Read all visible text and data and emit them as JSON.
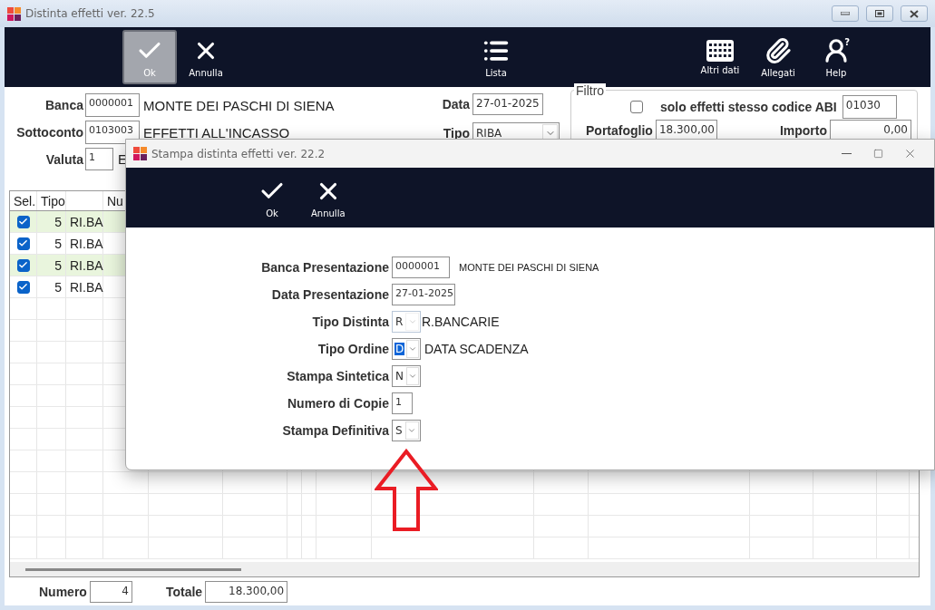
{
  "main_window": {
    "title": "Distinta effetti  ver. 22.5"
  },
  "toolbar": {
    "left": [
      {
        "label": "Ok",
        "active": true
      },
      {
        "label": "Annulla",
        "active": false
      }
    ],
    "center": [
      {
        "label": "Lista",
        "active": false
      }
    ],
    "right": [
      {
        "label": "Altri dati",
        "active": false
      },
      {
        "label": "Allegati",
        "active": false
      },
      {
        "label": "Help",
        "active": false,
        "badge": "?"
      }
    ]
  },
  "form": {
    "banca": {
      "label": "Banca",
      "code": "0000001",
      "description": "MONTE DEI PASCHI DI SIENA"
    },
    "sottoconto": {
      "label": "Sottoconto",
      "code": "0103003",
      "description": "EFFETTI ALL'INCASSO"
    },
    "valuta": {
      "label": "Valuta",
      "code": "1",
      "description": "E"
    },
    "data": {
      "label": "Data",
      "value": "27-01-2025"
    },
    "tipo": {
      "label": "Tipo",
      "value": "RIBA"
    }
  },
  "filter": {
    "title": "Filtro",
    "same_abi": {
      "label": "solo effetti stesso codice ABI",
      "checked": false,
      "value": "01030"
    },
    "portafoglio": {
      "label": "Portafoglio",
      "value": "18.300,00"
    },
    "importo": {
      "label": "Importo",
      "value": "0,00"
    }
  },
  "table": {
    "columns": [
      "Sel.",
      "Tipo",
      "Nu"
    ],
    "rows": [
      {
        "checked": true,
        "number": "5",
        "type": "RI.BA"
      },
      {
        "checked": true,
        "number": "5",
        "type": "RI.BA"
      },
      {
        "checked": true,
        "number": "5",
        "type": "RI.BA"
      },
      {
        "checked": true,
        "number": "5",
        "type": "RI.BA"
      }
    ]
  },
  "footer": {
    "numero": {
      "label": "Numero",
      "value": "4"
    },
    "totale": {
      "label": "Totale",
      "value": "18.300,00"
    }
  },
  "dialog": {
    "title": "Stampa distinta effetti  ver. 22.2",
    "toolbar": [
      {
        "label": "Ok"
      },
      {
        "label": "Annulla"
      }
    ],
    "fields": [
      {
        "kind": "text",
        "label": "Banca Presentazione",
        "value": "0000001",
        "description": "MONTE DEI PASCHI DI SIENA"
      },
      {
        "kind": "text",
        "label": "Data Presentazione",
        "value": "27-01-2025"
      },
      {
        "kind": "combo",
        "label": "Tipo Distinta",
        "value": "R",
        "description": "R.BANCARIE",
        "disabled": true,
        "highlighted": false
      },
      {
        "kind": "combo",
        "label": "Tipo Ordine",
        "value": "D",
        "description": "DATA SCADENZA",
        "disabled": false,
        "highlighted": true
      },
      {
        "kind": "combo",
        "label": "Stampa Sintetica",
        "value": "N",
        "disabled": false,
        "highlighted": false
      },
      {
        "kind": "text",
        "label": "Numero di Copie",
        "value": "1"
      },
      {
        "kind": "combo",
        "label": "Stampa Definitiva",
        "value": "S",
        "disabled": false,
        "highlighted": false
      }
    ]
  }
}
